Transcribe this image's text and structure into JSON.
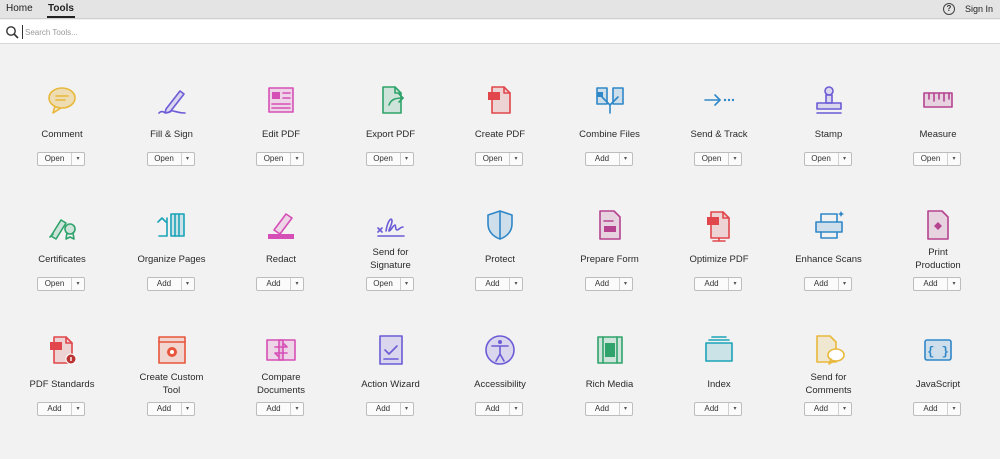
{
  "nav": {
    "home": "Home",
    "tools": "Tools",
    "help": "?",
    "sign_in": "Sign In"
  },
  "search": {
    "placeholder": "Search Tools..."
  },
  "dropdown_glyph": "▾",
  "tools": [
    {
      "label": "Comment",
      "action": "Open",
      "icon": "comment-icon",
      "color": "#e8b83b"
    },
    {
      "label": "Fill & Sign",
      "action": "Open",
      "icon": "fill-sign-icon",
      "color": "#6b5bd6"
    },
    {
      "label": "Edit PDF",
      "action": "Open",
      "icon": "edit-pdf-icon",
      "color": "#d64fb6"
    },
    {
      "label": "Export PDF",
      "action": "Open",
      "icon": "export-pdf-icon",
      "color": "#2fa36b"
    },
    {
      "label": "Create PDF",
      "action": "Open",
      "icon": "create-pdf-icon",
      "color": "#e0464b"
    },
    {
      "label": "Combine Files",
      "action": "Add",
      "icon": "combine-files-icon",
      "color": "#2f87c8"
    },
    {
      "label": "Send & Track",
      "action": "Open",
      "icon": "send-track-icon",
      "color": "#2f87c8"
    },
    {
      "label": "Stamp",
      "action": "Open",
      "icon": "stamp-icon",
      "color": "#6b5bd6"
    },
    {
      "label": "Measure",
      "action": "Open",
      "icon": "measure-icon",
      "color": "#b5438f"
    },
    {
      "label": "Certificates",
      "action": "Open",
      "icon": "certificates-icon",
      "color": "#2fa36b"
    },
    {
      "label": "Organize Pages",
      "action": "Add",
      "icon": "organize-pages-icon",
      "color": "#1aa3b8"
    },
    {
      "label": "Redact",
      "action": "Add",
      "icon": "redact-icon",
      "color": "#d64fb6"
    },
    {
      "label": "Send for Signature",
      "action": "Open",
      "icon": "send-signature-icon",
      "color": "#6b5bd6"
    },
    {
      "label": "Protect",
      "action": "Add",
      "icon": "protect-icon",
      "color": "#2f87c8"
    },
    {
      "label": "Prepare Form",
      "action": "Add",
      "icon": "prepare-form-icon",
      "color": "#b5438f"
    },
    {
      "label": "Optimize PDF",
      "action": "Add",
      "icon": "optimize-pdf-icon",
      "color": "#e0464b"
    },
    {
      "label": "Enhance Scans",
      "action": "Add",
      "icon": "enhance-scans-icon",
      "color": "#2f87c8"
    },
    {
      "label": "Print Production",
      "action": "Add",
      "icon": "print-production-icon",
      "color": "#b5438f"
    },
    {
      "label": "PDF Standards",
      "action": "Add",
      "icon": "pdf-standards-icon",
      "color": "#e0464b"
    },
    {
      "label": "Create Custom Tool",
      "action": "Add",
      "icon": "create-custom-tool-icon",
      "color": "#e8553b"
    },
    {
      "label": "Compare Documents",
      "action": "Add",
      "icon": "compare-documents-icon",
      "color": "#d64fb6"
    },
    {
      "label": "Action Wizard",
      "action": "Add",
      "icon": "action-wizard-icon",
      "color": "#6b5bd6"
    },
    {
      "label": "Accessibility",
      "action": "Add",
      "icon": "accessibility-icon",
      "color": "#6b5bd6"
    },
    {
      "label": "Rich Media",
      "action": "Add",
      "icon": "rich-media-icon",
      "color": "#2fa36b"
    },
    {
      "label": "Index",
      "action": "Add",
      "icon": "index-icon",
      "color": "#1aa3b8"
    },
    {
      "label": "Send for Comments",
      "action": "Add",
      "icon": "send-comments-icon",
      "color": "#e8b83b"
    },
    {
      "label": "JavaScript",
      "action": "Add",
      "icon": "javascript-icon",
      "color": "#2f87c8"
    }
  ]
}
